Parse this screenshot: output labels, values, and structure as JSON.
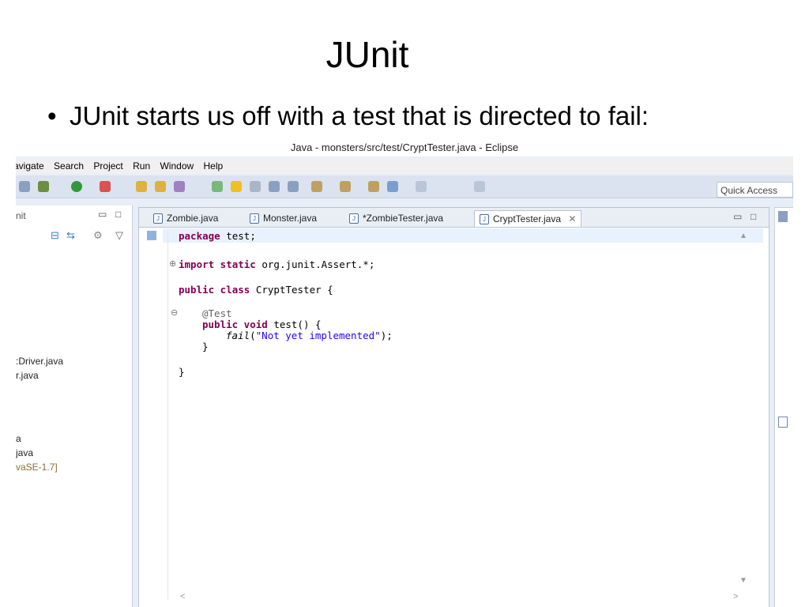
{
  "slide": {
    "title": "JUnit",
    "bullet": "JUnit starts us off with a test that is directed to fail:"
  },
  "window": {
    "title": "Java - monsters/src/test/CryptTester.java - Eclipse"
  },
  "menu": [
    "avigate",
    "Search",
    "Project",
    "Run",
    "Window",
    "Help"
  ],
  "toolbar": {
    "quick_access": "Quick Access"
  },
  "left_panel": {
    "title": "nit",
    "items": [
      ":Driver.java",
      "r.java",
      "a",
      "java",
      "vaSE-1.7]"
    ]
  },
  "editor": {
    "tabs": [
      {
        "label": "Zombie.java",
        "active": false
      },
      {
        "label": "Monster.java",
        "active": false
      },
      {
        "label": "*ZombieTester.java",
        "active": false
      },
      {
        "label": "CryptTester.java",
        "active": true
      }
    ],
    "code": {
      "pkg_kw": "package",
      "pkg_rest": " test;",
      "import_kw": "import static",
      "import_rest": " org.junit.Assert.*;",
      "class_kw": "public class",
      "class_rest": " CryptTester {",
      "annotation": "@Test",
      "method_kw": "public void",
      "method_rest": " test() {",
      "fail_call": "fail",
      "fail_open": "(",
      "fail_str": "\"Not yet implemented\"",
      "fail_close": ");",
      "close_method": "}",
      "close_class": "}"
    }
  },
  "colors": {
    "keyword": "#7f0055",
    "string": "#2a00ff",
    "annotation": "#646464",
    "toolbar_bg": "#dbe3f0"
  }
}
